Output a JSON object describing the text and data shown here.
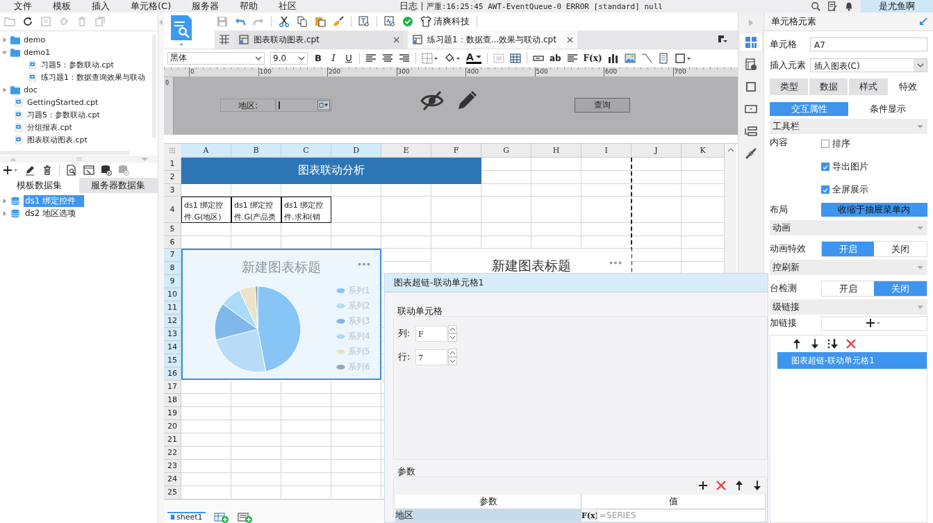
{
  "menu": [
    "文件",
    "模板",
    "插入",
    "单元格(C)",
    "服务器",
    "帮助",
    "社区"
  ],
  "log": {
    "label": "日志",
    "message": "严重:16:25:45 AWT-EventQueue-0 ERROR [standard] null"
  },
  "user": "是尤鱼啊",
  "file_tree": [
    {
      "label": "demo",
      "kind": "folder",
      "expanded": false
    },
    {
      "label": "demo1",
      "kind": "folder",
      "expanded": true,
      "children": [
        {
          "label": "习题5：参数联动.cpt",
          "kind": "file"
        },
        {
          "label": "练习题1：数据查询效果与联动",
          "kind": "file"
        }
      ]
    },
    {
      "label": "doc",
      "kind": "folder",
      "expanded": false
    },
    {
      "label": "GettingStarted.cpt",
      "kind": "file"
    },
    {
      "label": "习题5：参数联动.cpt",
      "kind": "file"
    },
    {
      "label": "分组报表.cpt",
      "kind": "file"
    },
    {
      "label": "图表联动图表.cpt",
      "kind": "file"
    }
  ],
  "dataset_tabs": [
    {
      "label": "模板数据集",
      "selected": true
    },
    {
      "label": "服务器数据集",
      "selected": false
    }
  ],
  "datasets": [
    {
      "label": "ds1 绑定控件",
      "selected": true
    },
    {
      "label": "ds2 地区选项",
      "selected": false
    }
  ],
  "toolbar": {
    "brand": "清爽科技"
  },
  "file_tabs": [
    {
      "label": "图表联动图表.cpt",
      "selected": false
    },
    {
      "label": "练习题1：数据查...效果与联动.cpt",
      "selected": true
    }
  ],
  "format_bar": {
    "font": "黑体",
    "size": "9.0",
    "style_buttons": [
      "B",
      "I",
      "U"
    ],
    "font_color_glyph": "A",
    "text_glyph": "ab",
    "formula_glyph": "F(x)"
  },
  "ruler": [
    "0",
    "100",
    "200",
    "300",
    "400",
    "500",
    "600",
    "700"
  ],
  "parameter_pane": {
    "ruler_zero": "0",
    "label": "地区:",
    "query_button": "查询"
  },
  "sheet": {
    "columns": [
      {
        "label": "A",
        "selected": true
      },
      {
        "label": "B",
        "selected": true
      },
      {
        "label": "C",
        "selected": true
      },
      {
        "label": "D",
        "selected": true
      },
      {
        "label": "E",
        "selected": false
      },
      {
        "label": "F",
        "selected": false
      },
      {
        "label": "G",
        "selected": false
      },
      {
        "label": "H",
        "selected": false
      },
      {
        "label": "I",
        "selected": false
      },
      {
        "label": "J",
        "selected": false
      },
      {
        "label": "K",
        "selected": false
      }
    ],
    "rows": [
      {
        "label": "1",
        "selected": false
      },
      {
        "label": "2",
        "selected": false
      },
      {
        "label": "3",
        "selected": false
      },
      {
        "label": "4",
        "selected": false
      },
      {
        "label": "5",
        "selected": false
      },
      {
        "label": "6",
        "selected": false
      },
      {
        "label": "7",
        "selected": true
      },
      {
        "label": "8",
        "selected": true
      },
      {
        "label": "9",
        "selected": true
      },
      {
        "label": "10",
        "selected": true
      },
      {
        "label": "11",
        "selected": true
      },
      {
        "label": "12",
        "selected": true
      },
      {
        "label": "13",
        "selected": true
      },
      {
        "label": "14",
        "selected": true
      },
      {
        "label": "15",
        "selected": true
      },
      {
        "label": "16",
        "selected": true
      },
      {
        "label": "17",
        "selected": false
      },
      {
        "label": "18",
        "selected": false
      },
      {
        "label": "19",
        "selected": false
      },
      {
        "label": "20",
        "selected": false
      },
      {
        "label": "21",
        "selected": false
      },
      {
        "label": "22",
        "selected": false
      },
      {
        "label": "23",
        "selected": false
      },
      {
        "label": "24",
        "selected": false
      },
      {
        "label": "25",
        "selected": false
      }
    ],
    "title_cell": "图表联动分析",
    "field_cells": [
      "ds1 绑定控件.G(地区)",
      "ds1 绑定控件.G(产品类",
      "ds1 绑定控件.求和(销"
    ]
  },
  "charts": [
    {
      "title": "新建图表标题",
      "selected": true,
      "legend": [
        {
          "label": "系列1",
          "color": "#86c5f5"
        },
        {
          "label": "系列2",
          "color": "#b8dcf7"
        },
        {
          "label": "系列3",
          "color": "#80b8ec"
        },
        {
          "label": "系列4",
          "color": "#a9dbfb"
        },
        {
          "label": "系列5",
          "color": "#eae3c8"
        },
        {
          "label": "系列6",
          "color": "#98a9b6"
        }
      ]
    },
    {
      "title": "新建图表标题",
      "selected": false
    }
  ],
  "sheet_tabs": [
    {
      "label": "sheet1",
      "selected": true
    }
  ],
  "dialog": {
    "title": "图表超链-联动单元格1",
    "linked_cell": {
      "title": "联动单元格",
      "column_label": "列:",
      "column_value": "F",
      "row_label": "行:",
      "row_value": "7"
    },
    "parameters": {
      "title": "参数",
      "columns": [
        "参数",
        "值"
      ],
      "rows": [
        {
          "name": "地区",
          "formula_glyph": "F(x)",
          "value": "=SERIES",
          "selected": true
        }
      ]
    }
  },
  "side_tabs": [
    {
      "kind": "cell",
      "selected": true
    },
    {
      "kind": "report",
      "selected": false
    },
    {
      "kind": "border",
      "selected": false
    },
    {
      "kind": "widget",
      "selected": false
    },
    {
      "kind": "condition",
      "selected": false
    },
    {
      "kind": "link",
      "selected": false
    }
  ],
  "cell_panel": {
    "title": "单元格元素",
    "cell_label": "单元格",
    "cell_value": "A7",
    "insert_label": "插入元素",
    "insert_value": "插入图表(C)",
    "tabs": [
      {
        "label": "类型",
        "selected": false
      },
      {
        "label": "数据",
        "selected": false
      },
      {
        "label": "样式",
        "selected": false
      },
      {
        "label": "特效",
        "selected": true
      }
    ],
    "subtabs": [
      {
        "label": "交互属性",
        "selected": true
      },
      {
        "label": "条件显示",
        "selected": false
      }
    ],
    "sections": [
      {
        "title": "工具栏",
        "rows": [
          {
            "kind": "checks",
            "label": "内容",
            "items": [
              {
                "label": "排序",
                "checked": false
              },
              {
                "label": "导出图片",
                "checked": true
              },
              {
                "label": "全屏展示",
                "checked": true
              }
            ]
          },
          {
            "kind": "button",
            "label": "布局",
            "button": "收缩于抽屉菜单内"
          }
        ]
      },
      {
        "title": "动画",
        "rows": [
          {
            "kind": "toggle",
            "label": "动画特效",
            "options": [
              {
                "label": "开启",
                "selected": true
              },
              {
                "label": "关闭",
                "selected": false
              }
            ]
          }
        ]
      },
      {
        "title": "控刷新",
        "rows": [
          {
            "kind": "toggle",
            "label": "台检测",
            "options": [
              {
                "label": "开启",
                "selected": false
              },
              {
                "label": "关闭",
                "selected": true
              }
            ]
          }
        ]
      },
      {
        "title": "级链接",
        "rows": [
          {
            "kind": "add",
            "label": "加链接"
          },
          {
            "kind": "links",
            "items": [
              {
                "label": "图表超链-联动单元格1",
                "selected": true
              }
            ]
          }
        ]
      }
    ]
  }
}
